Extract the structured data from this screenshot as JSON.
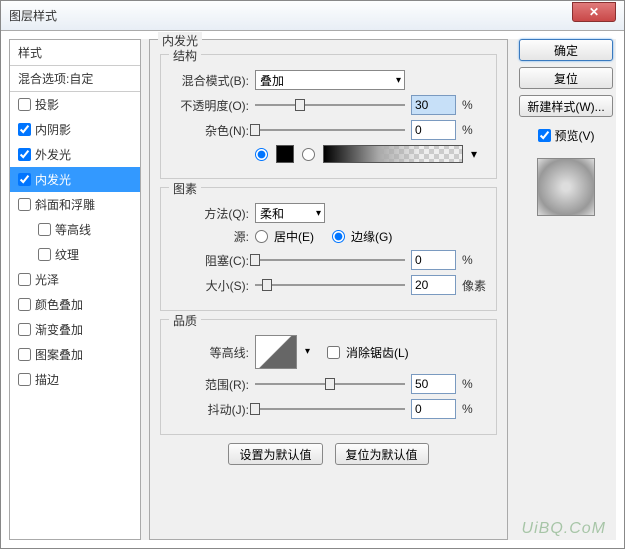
{
  "window": {
    "title": "图层样式"
  },
  "left": {
    "header": "样式",
    "blend_header": "混合选项:自定",
    "items": [
      {
        "label": "投影",
        "checked": false,
        "indent": false
      },
      {
        "label": "内阴影",
        "checked": true,
        "indent": false
      },
      {
        "label": "外发光",
        "checked": true,
        "indent": false
      },
      {
        "label": "内发光",
        "checked": true,
        "indent": false,
        "selected": true
      },
      {
        "label": "斜面和浮雕",
        "checked": false,
        "indent": false
      },
      {
        "label": "等高线",
        "checked": false,
        "indent": true
      },
      {
        "label": "纹理",
        "checked": false,
        "indent": true
      },
      {
        "label": "光泽",
        "checked": false,
        "indent": false
      },
      {
        "label": "颜色叠加",
        "checked": false,
        "indent": false
      },
      {
        "label": "渐变叠加",
        "checked": false,
        "indent": false
      },
      {
        "label": "图案叠加",
        "checked": false,
        "indent": false
      },
      {
        "label": "描边",
        "checked": false,
        "indent": false
      }
    ]
  },
  "mid": {
    "title": "内发光",
    "structure": {
      "legend": "结构",
      "blend_label": "混合模式(B):",
      "blend_value": "叠加",
      "opacity_label": "不透明度(O):",
      "opacity_value": "30",
      "opacity_pct": 30,
      "noise_label": "杂色(N):",
      "noise_value": "0",
      "noise_pct": 0,
      "percent": "%"
    },
    "elements": {
      "legend": "图素",
      "technique_label": "方法(Q):",
      "technique_value": "柔和",
      "source_label": "源:",
      "center_label": "居中(E)",
      "edge_label": "边缘(G)",
      "choke_label": "阻塞(C):",
      "choke_value": "0",
      "choke_pct": 0,
      "size_label": "大小(S):",
      "size_value": "20",
      "size_pct": 8,
      "px_unit": "像素",
      "percent": "%"
    },
    "quality": {
      "legend": "品质",
      "contour_label": "等高线:",
      "antialias_label": "消除锯齿(L)",
      "range_label": "范围(R):",
      "range_value": "50",
      "range_pct": 50,
      "jitter_label": "抖动(J):",
      "jitter_value": "0",
      "jitter_pct": 0,
      "percent": "%"
    },
    "buttons": {
      "default": "设置为默认值",
      "reset": "复位为默认值"
    }
  },
  "right": {
    "ok": "确定",
    "cancel": "复位",
    "new_style": "新建样式(W)...",
    "preview": "预览(V)"
  },
  "watermark": "UiBQ.CoM"
}
